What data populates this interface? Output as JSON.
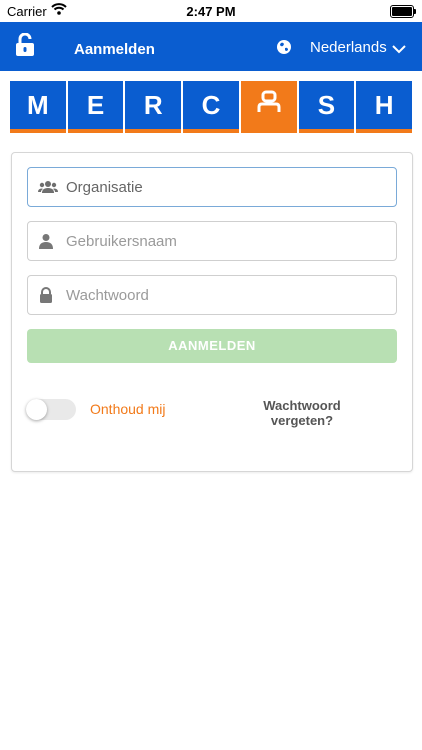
{
  "status_bar": {
    "carrier": "Carrier",
    "time": "2:47 PM"
  },
  "nav": {
    "title": "Aanmelden",
    "language": "Nederlands",
    "icons": [
      "unlock-icon",
      "globe-icon",
      "chevron-down-icon"
    ]
  },
  "logo": {
    "letters": [
      "M",
      "E",
      "R",
      "C",
      "",
      "S",
      "H"
    ],
    "colors": {
      "blue": "#0a5dd0",
      "orange": "#f27a1a"
    }
  },
  "form": {
    "organisation_placeholder": "Organisatie",
    "username_placeholder": "Gebruikersnaam",
    "password_placeholder": "Wachtwoord",
    "login_label": "AANMELDEN",
    "remember_label": "Onthoud mij",
    "remember_enabled": false,
    "forgot_label": "Wachtwoord vergeten?"
  },
  "colors": {
    "accent": "#0a5dd0",
    "orange": "#f27a1a",
    "button_disabled": "#b8e0b3"
  }
}
